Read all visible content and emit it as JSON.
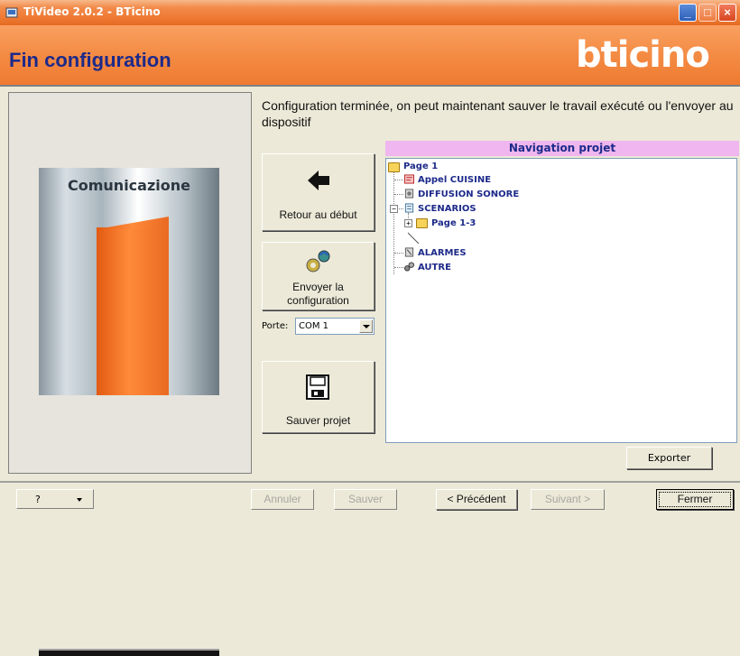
{
  "window": {
    "title": "TiVideo 2.0.2 - BTicino"
  },
  "header": {
    "title": "Fin configuration",
    "logo": "bticino"
  },
  "image": {
    "title": "Comunicazione"
  },
  "description": "Configuration terminée, on peut maintenant sauver le travail exécuté ou l'envoyer au dispositif",
  "actions": {
    "retour": "Retour au début",
    "envoyer_line1": "Envoyer la",
    "envoyer_line2": "configuration",
    "sauver": "Sauver projet"
  },
  "porte": {
    "label": "Porte:",
    "value": "COM 1"
  },
  "navigation": {
    "header": "Navigation projet",
    "items": [
      {
        "label": "Page 1",
        "icon": "folder-icon"
      },
      {
        "label": "Appel CUISINE",
        "icon": "call-icon"
      },
      {
        "label": "DIFFUSION SONORE",
        "icon": "speaker-icon"
      },
      {
        "label": "SCENARIOS",
        "icon": "scenario-icon"
      },
      {
        "label": "Page 1-3",
        "icon": "folder-icon"
      },
      {
        "label": "ALARMES",
        "icon": "alarm-icon"
      },
      {
        "label": "AUTRE",
        "icon": "other-icon"
      }
    ]
  },
  "exporter": "Exporter",
  "bottom": {
    "help": "?",
    "annuler": "Annuler",
    "sauver": "Sauver",
    "precedent": "< Précédent",
    "suivant": "Suivant >",
    "fermer": "Fermer"
  },
  "colors": {
    "accent": "#EF7A31",
    "title_blue": "#1D2A8A",
    "nav_header_bg": "#EFB6EF"
  }
}
